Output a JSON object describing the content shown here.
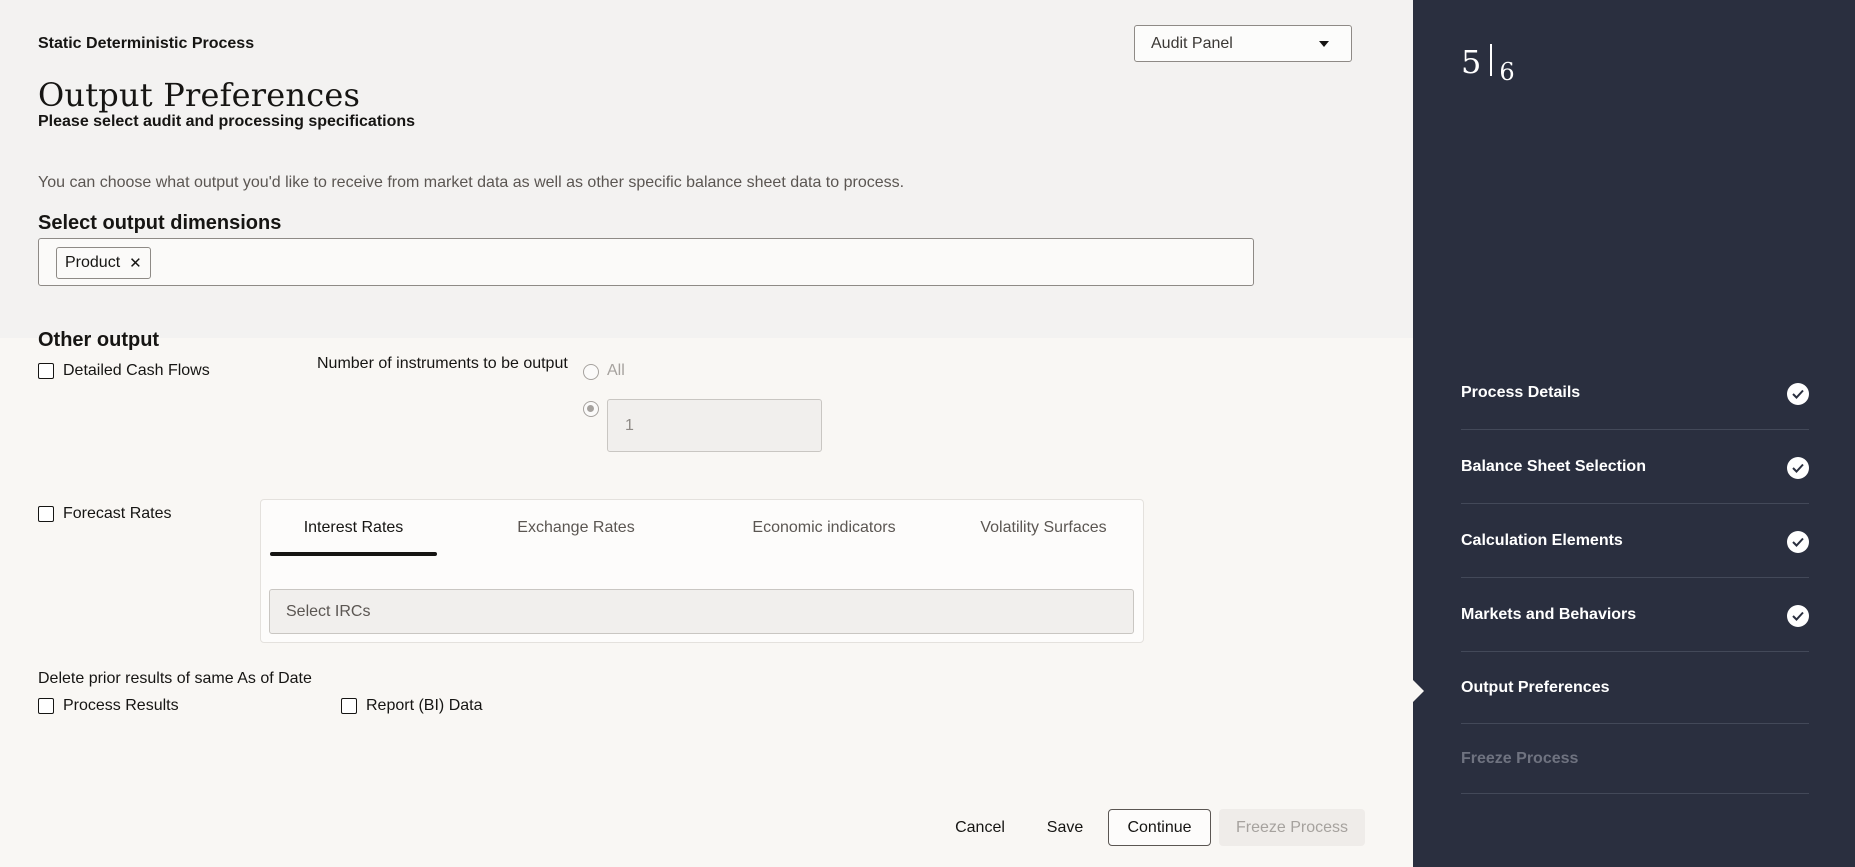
{
  "header": {
    "process_name": "Static Deterministic Process",
    "title": "Output Preferences",
    "subtitle": "Please select audit and processing specifications",
    "description": "You can choose what output you'd like to receive from market data as well as other specific balance sheet data to process."
  },
  "audit_panel": {
    "label": "Audit Panel",
    "icon": "caret-down-icon"
  },
  "output_dimensions": {
    "heading": "Select output dimensions",
    "chips": [
      {
        "label": "Product",
        "remove_icon": "close-icon"
      }
    ]
  },
  "other_output": {
    "heading": "Other output",
    "detailed_cash_flows": {
      "label": "Detailed Cash Flows",
      "checked": false
    },
    "instruments": {
      "label": "Number of instruments to be output",
      "option_all": "All",
      "selected": "custom",
      "custom_value": "1"
    },
    "forecast_rates": {
      "label": "Forecast Rates",
      "checked": false
    }
  },
  "forecast_tabs": {
    "tabs": [
      {
        "label": "Interest Rates",
        "active": true
      },
      {
        "label": "Exchange Rates",
        "active": false
      },
      {
        "label": "Economic indicators",
        "active": false
      },
      {
        "label": "Volatility Surfaces",
        "active": false
      }
    ],
    "irc_placeholder": "Select IRCs"
  },
  "delete_prior": {
    "label": "Delete prior results of same As of Date",
    "process_results": {
      "label": "Process Results",
      "checked": false
    },
    "report_data": {
      "label": "Report (BI) Data",
      "checked": false
    }
  },
  "actions": {
    "cancel": "Cancel",
    "save": "Save",
    "continue": "Continue",
    "freeze": "Freeze Process"
  },
  "train": {
    "current": "5",
    "total": "6",
    "steps": [
      {
        "label": "Process Details",
        "status": "complete",
        "icon": "checkmark-icon"
      },
      {
        "label": "Balance Sheet Selection",
        "status": "complete",
        "icon": "checkmark-icon"
      },
      {
        "label": "Calculation Elements",
        "status": "complete",
        "icon": "checkmark-icon"
      },
      {
        "label": "Markets and Behaviors",
        "status": "complete",
        "icon": "checkmark-icon"
      },
      {
        "label": "Output Preferences",
        "status": "current"
      },
      {
        "label": "Freeze Process",
        "status": "disabled"
      }
    ]
  },
  "colors": {
    "sidebar_bg": "#2a2f3f",
    "page_bg": "#f9f7f4",
    "accent": "#161513",
    "disabled_text": "#6f7380"
  }
}
